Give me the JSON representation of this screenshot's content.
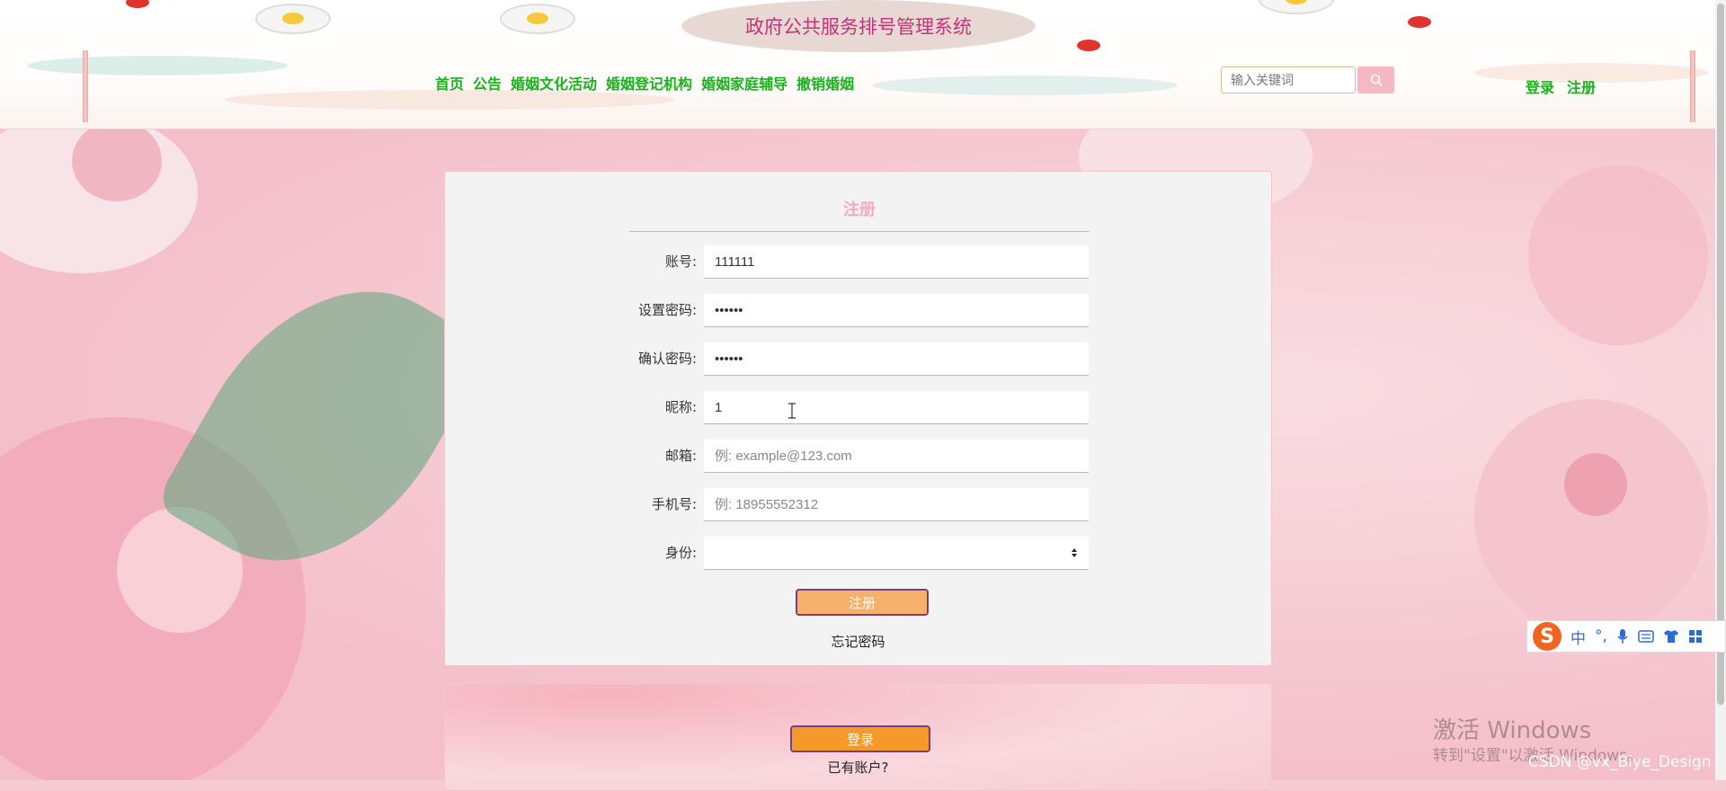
{
  "header": {
    "title": "政府公共服务排号管理系统",
    "nav": [
      "首页",
      "公告",
      "婚姻文化活动",
      "婚姻登记机构",
      "婚姻家庭辅导",
      "撤销婚姻"
    ],
    "search_placeholder": "输入关键词",
    "login": "登录",
    "register": "注册"
  },
  "form": {
    "title": "注册",
    "fields": [
      {
        "label": "账号:",
        "value": "111111",
        "placeholder": ""
      },
      {
        "label": "设置密码:",
        "value": "••••••",
        "placeholder": ""
      },
      {
        "label": "确认密码:",
        "value": "••••••",
        "placeholder": ""
      },
      {
        "label": "昵称:",
        "value": "1",
        "placeholder": ""
      },
      {
        "label": "邮箱:",
        "value": "",
        "placeholder": "例: example@123.com"
      },
      {
        "label": "手机号:",
        "value": "",
        "placeholder": "例: 18955552312"
      },
      {
        "label": "身份:",
        "value": ""
      }
    ],
    "submit": "注册",
    "forgot": "忘记密码"
  },
  "second_card": {
    "login": "登录",
    "has_account": "已有账户?"
  },
  "ime": {
    "chars": [
      "中",
      "°,"
    ]
  },
  "watermark": {
    "line1": "激活 Windows",
    "line2": "转到\"设置\"以激活 Windows。",
    "credit": "CSDN @vx_Biye_Design"
  },
  "colors": {
    "nav_green": "#17b31a",
    "title_pink": "#c9317a",
    "card_bg": "#f3f3f3",
    "accent_pink": "#f6a9bb"
  }
}
